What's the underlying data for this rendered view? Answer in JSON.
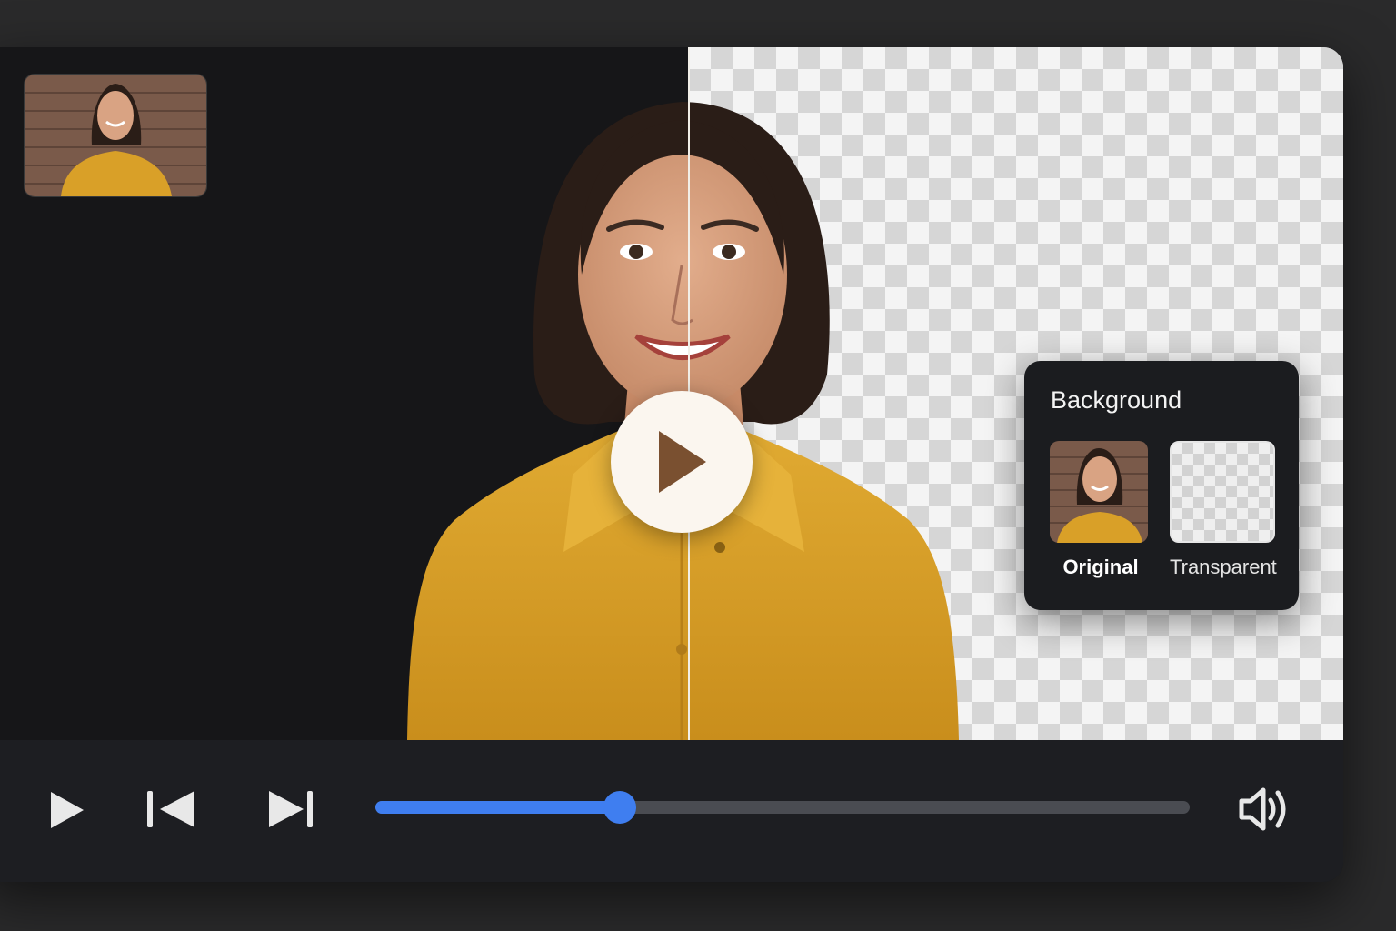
{
  "background_panel": {
    "title": "Background",
    "options": [
      {
        "label": "Original",
        "selected": true
      },
      {
        "label": "Transparent",
        "selected": false
      }
    ]
  },
  "controls": {
    "play_icon": "play-icon",
    "previous_icon": "skip-previous-icon",
    "next_icon": "skip-next-icon",
    "volume_icon": "volume-icon",
    "progress": 0.3
  },
  "colors": {
    "accent": "#3f7ef0",
    "shirt": "#d9a028",
    "dark_bg": "#161618"
  }
}
